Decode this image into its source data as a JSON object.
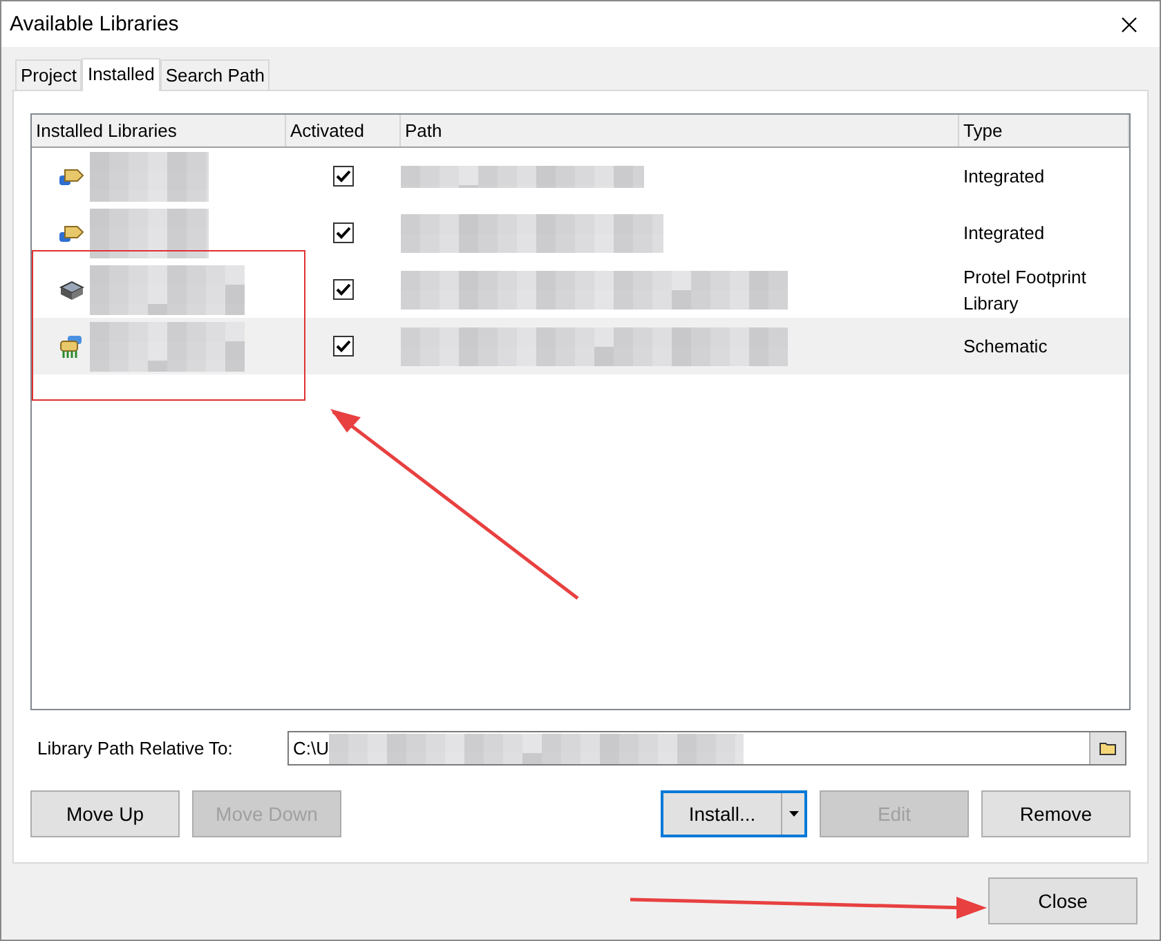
{
  "window": {
    "title": "Available Libraries"
  },
  "tabs": [
    {
      "label": "Project",
      "selected": false
    },
    {
      "label": "Installed",
      "selected": true
    },
    {
      "label": "Search Path",
      "selected": false
    }
  ],
  "table": {
    "columns": [
      "Installed Libraries",
      "Activated",
      "Path",
      "Type"
    ],
    "rows": [
      {
        "kind": "integrated",
        "activated": true,
        "type": "Integrated",
        "selected": false
      },
      {
        "kind": "integrated",
        "activated": true,
        "type": "Integrated",
        "selected": false
      },
      {
        "kind": "footprint",
        "activated": true,
        "type": "Protel Footprint Library",
        "selected": false
      },
      {
        "kind": "schematic",
        "activated": true,
        "type": "Schematic",
        "selected": true
      }
    ]
  },
  "path_field": {
    "label": "Library Path Relative To:",
    "value": "C:\\U"
  },
  "buttons": [
    {
      "label": "Move Up",
      "disabled": false
    },
    {
      "label": "Move Down",
      "disabled": true
    }
  ],
  "right_buttons": [
    {
      "kind": "split",
      "label": "Install...",
      "disabled": false
    },
    {
      "kind": "plain",
      "label": "Edit",
      "disabled": true
    },
    {
      "kind": "plain",
      "label": "Remove",
      "disabled": false
    }
  ],
  "close_button": {
    "label": "Close"
  }
}
